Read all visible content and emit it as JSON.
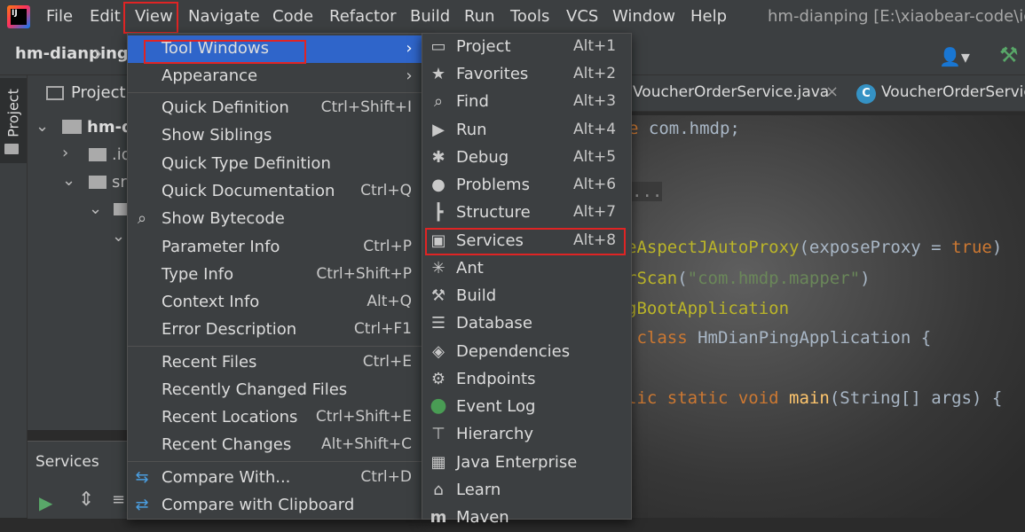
{
  "menubar": {
    "items": [
      "File",
      "Edit",
      "View",
      "Navigate",
      "Code",
      "Refactor",
      "Build",
      "Run",
      "Tools",
      "VCS",
      "Window",
      "Help"
    ],
    "window_title": "hm-dianping [E:\\xiaobear-code\\idea"
  },
  "toolbar": {
    "project_name": "hm-dianping"
  },
  "left_strip": {
    "project_tab": "Project"
  },
  "project_panel": {
    "header": "Project",
    "tree": [
      "hm-d",
      ".id",
      "sr"
    ]
  },
  "services_panel": {
    "title": "Services"
  },
  "editor": {
    "tabs": [
      "VoucherOrderService.java",
      "VoucherOrderServic"
    ],
    "tab_icon_letter": "C",
    "lines": [
      "e com.hmdp;",
      "...",
      "eAspectJAutoProxy(exposeProxy = true)",
      "rScan(\"com.hmdp.mapper\")",
      "gBootApplication",
      " class HmDianPingApplication {",
      "lic static void main(String[] args) {"
    ]
  },
  "view_menu": {
    "items": [
      {
        "label": "Tool Windows",
        "shortcut": "",
        "submenu": true
      },
      {
        "label": "Appearance",
        "shortcut": "",
        "submenu": true
      },
      {
        "label": "Quick Definition",
        "shortcut": "Ctrl+Shift+I"
      },
      {
        "label": "Show Siblings",
        "shortcut": ""
      },
      {
        "label": "Quick Type Definition",
        "shortcut": ""
      },
      {
        "label": "Quick Documentation",
        "shortcut": "Ctrl+Q"
      },
      {
        "label": "Show Bytecode",
        "shortcut": ""
      },
      {
        "label": "Parameter Info",
        "shortcut": "Ctrl+P"
      },
      {
        "label": "Type Info",
        "shortcut": "Ctrl+Shift+P"
      },
      {
        "label": "Context Info",
        "shortcut": "Alt+Q"
      },
      {
        "label": "Error Description",
        "shortcut": "Ctrl+F1"
      },
      {
        "label": "Recent Files",
        "shortcut": "Ctrl+E"
      },
      {
        "label": "Recently Changed Files",
        "shortcut": ""
      },
      {
        "label": "Recent Locations",
        "shortcut": "Ctrl+Shift+E"
      },
      {
        "label": "Recent Changes",
        "shortcut": "Alt+Shift+C"
      },
      {
        "label": "Compare With...",
        "shortcut": "Ctrl+D"
      },
      {
        "label": "Compare with Clipboard",
        "shortcut": ""
      }
    ]
  },
  "tool_windows_menu": {
    "items": [
      {
        "label": "Project",
        "shortcut": "Alt+1",
        "icon": "project-icon"
      },
      {
        "label": "Favorites",
        "shortcut": "Alt+2",
        "icon": "star-icon"
      },
      {
        "label": "Find",
        "shortcut": "Alt+3",
        "icon": "search-icon"
      },
      {
        "label": "Run",
        "shortcut": "Alt+4",
        "icon": "play-icon"
      },
      {
        "label": "Debug",
        "shortcut": "Alt+5",
        "icon": "bug-icon"
      },
      {
        "label": "Problems",
        "shortcut": "Alt+6",
        "icon": "warning-icon"
      },
      {
        "label": "Structure",
        "shortcut": "Alt+7",
        "icon": "structure-icon"
      },
      {
        "label": "Services",
        "shortcut": "Alt+8",
        "icon": "services-icon"
      },
      {
        "label": "Ant",
        "shortcut": "",
        "icon": "ant-icon"
      },
      {
        "label": "Build",
        "shortcut": "",
        "icon": "hammer-icon"
      },
      {
        "label": "Database",
        "shortcut": "",
        "icon": "database-icon"
      },
      {
        "label": "Dependencies",
        "shortcut": "",
        "icon": "dependencies-icon"
      },
      {
        "label": "Endpoints",
        "shortcut": "",
        "icon": "endpoints-icon"
      },
      {
        "label": "Event Log",
        "shortcut": "",
        "icon": "event-log-icon"
      },
      {
        "label": "Hierarchy",
        "shortcut": "",
        "icon": "hierarchy-icon"
      },
      {
        "label": "Java Enterprise",
        "shortcut": "",
        "icon": "java-enterprise-icon"
      },
      {
        "label": "Learn",
        "shortcut": "",
        "icon": "learn-icon"
      },
      {
        "label": "Maven",
        "shortcut": "",
        "icon": "maven-icon"
      }
    ]
  },
  "colors": {
    "menu_bg": "#3c3f41",
    "highlight": "#2f65ca",
    "annotation_box": "#e02424"
  }
}
